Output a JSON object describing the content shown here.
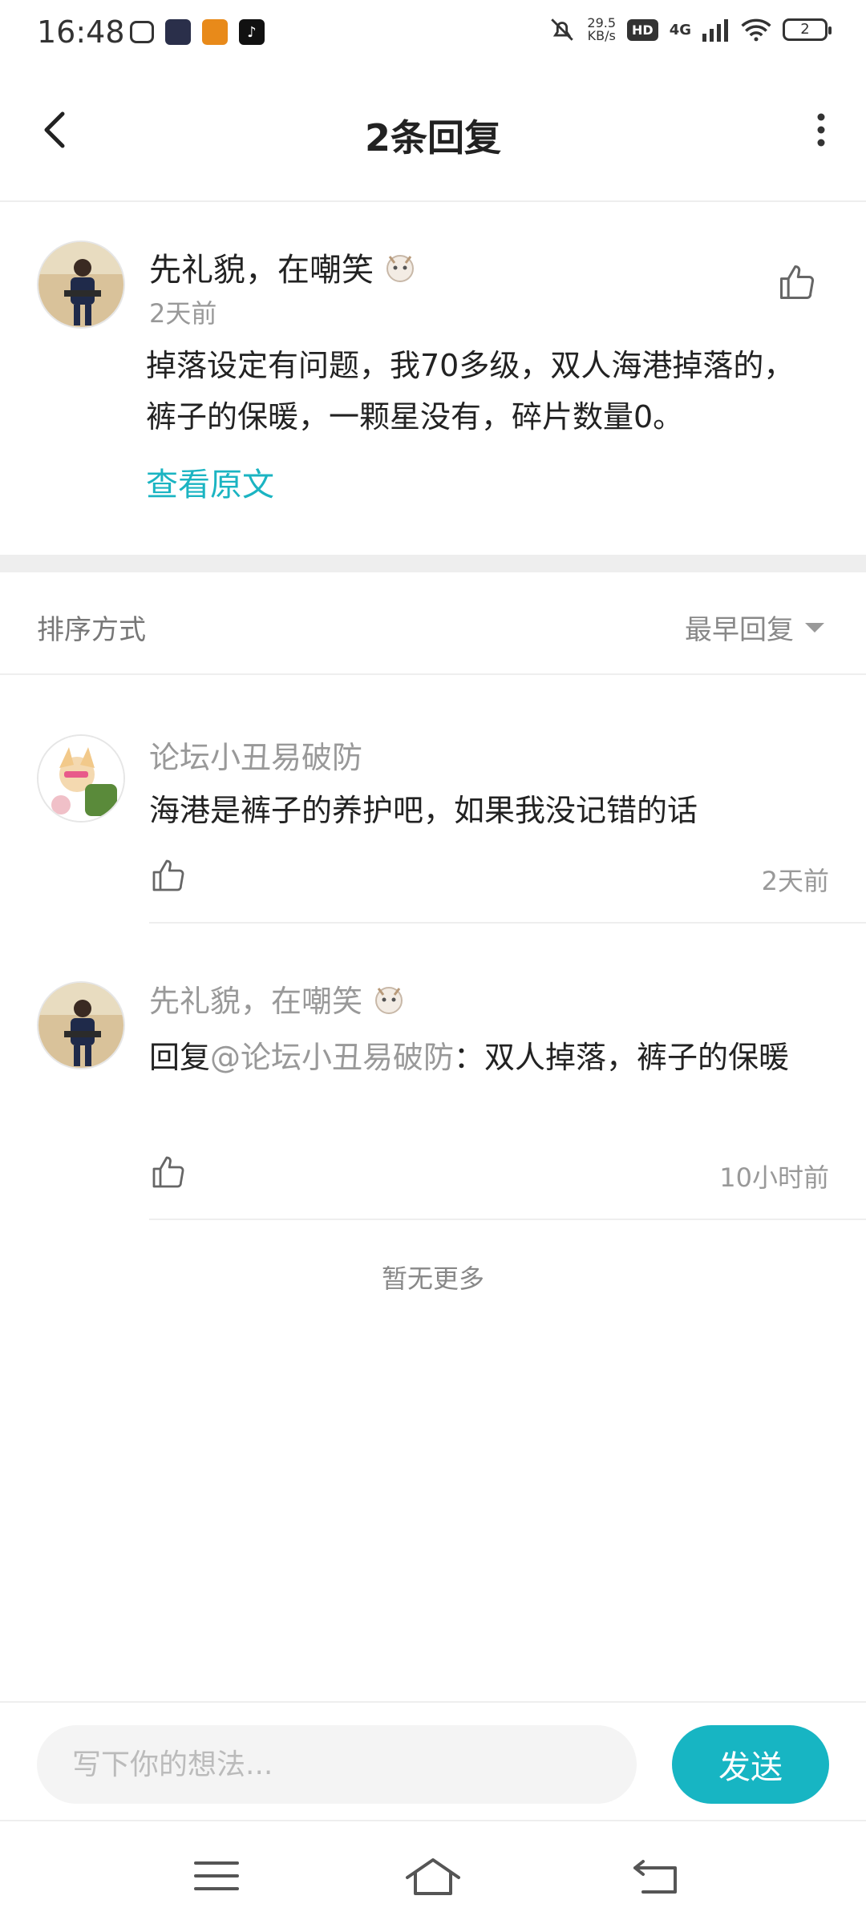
{
  "status_bar": {
    "time": "16:48",
    "net_speed_value": "29.5",
    "net_speed_unit": "KB/s",
    "hd_badge": "HD",
    "network": "4G",
    "battery": "2"
  },
  "header": {
    "title": "2条回复"
  },
  "original_comment": {
    "author": "先礼貌，在嘲笑",
    "time": "2天前",
    "text": "掉落设定有问题，我70多级，双人海港掉落的，裤子的保暖，一颗星没有，碎片数量0。",
    "view_original": "查看原文"
  },
  "sort": {
    "label": "排序方式",
    "selected": "最早回复"
  },
  "replies": [
    {
      "author": "论坛小丑易破防",
      "text": "海港是裤子的养护吧，如果我没记错的话",
      "time": "2天前"
    },
    {
      "author": "先礼貌，在嘲笑",
      "reply_prefix": "回复",
      "mention": "@论坛小丑易破防",
      "text": "：双人掉落，裤子的保暖",
      "time": "10小时前"
    }
  ],
  "no_more": "暂无更多",
  "composer": {
    "placeholder": "写下你的想法...",
    "send_label": "发送"
  },
  "colors": {
    "accent": "#17b5c3",
    "link": "#1bb4c2"
  }
}
